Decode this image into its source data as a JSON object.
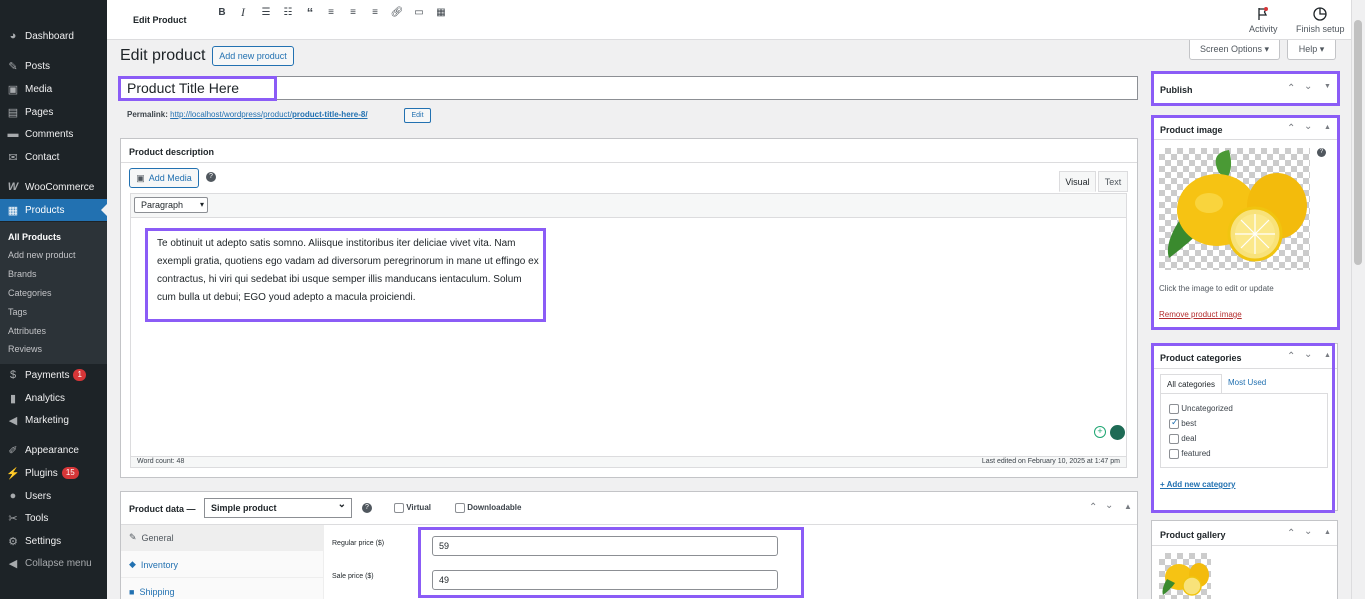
{
  "header": {
    "title": "Edit Product",
    "activity_label": "Activity",
    "finish_setup_label": "Finish setup"
  },
  "screen_options": "Screen Options ▾",
  "help": "Help ▾",
  "page": {
    "heading": "Edit product",
    "add_new": "Add new product",
    "product_title": "Product Title Here",
    "permalink_label": "Permalink:",
    "permalink_base": "http://localhost/wordpress/product/",
    "permalink_slug": "product-title-here-8/",
    "edit_slug": "Edit"
  },
  "sidebar": {
    "items": [
      {
        "label": "Dashboard",
        "icon": "dashboard-icon"
      },
      {
        "label": "Posts",
        "icon": "pin-icon"
      },
      {
        "label": "Media",
        "icon": "media-icon"
      },
      {
        "label": "Pages",
        "icon": "pages-icon"
      },
      {
        "label": "Comments",
        "icon": "comment-icon"
      },
      {
        "label": "Contact",
        "icon": "mail-icon"
      },
      {
        "label": "WooCommerce",
        "icon": "woo-icon"
      },
      {
        "label": "Products",
        "icon": "products-icon"
      },
      {
        "label": "Payments",
        "icon": "dollar-icon",
        "badge": "1"
      },
      {
        "label": "Analytics",
        "icon": "bar-chart-icon"
      },
      {
        "label": "Marketing",
        "icon": "megaphone-icon"
      },
      {
        "label": "Appearance",
        "icon": "brush-icon"
      },
      {
        "label": "Plugins",
        "icon": "plug-icon",
        "badge": "15"
      },
      {
        "label": "Users",
        "icon": "user-icon"
      },
      {
        "label": "Tools",
        "icon": "wrench-icon"
      },
      {
        "label": "Settings",
        "icon": "settings-icon"
      },
      {
        "label": "Collapse menu",
        "icon": "collapse-icon"
      }
    ],
    "submenu": [
      "All Products",
      "Add new product",
      "Brands",
      "Categories",
      "Tags",
      "Attributes",
      "Reviews"
    ]
  },
  "description_box": {
    "title": "Product description",
    "add_media": "Add Media",
    "tab_visual": "Visual",
    "tab_text": "Text",
    "format": "Paragraph",
    "content": "Te obtinuit ut adepto satis somno. Aliisque institoribus iter deliciae vivet vita. Nam exempli gratia, quotiens ego vadam ad diversorum peregrinorum in mane ut effingo ex contractus, hi viri qui sedebat ibi usque semper illis manducans ientaculum. Solum cum bulla ut debui; EGO youd adepto a macula proiciendi.",
    "word_count": "Word count: 48",
    "last_edited": "Last edited on February 10, 2025 at 1:47 pm"
  },
  "product_data": {
    "title": "Product data —",
    "type": "Simple product",
    "virtual": "Virtual",
    "downloadable": "Downloadable",
    "tabs": [
      {
        "label": "General",
        "icon": "wrench-icon"
      },
      {
        "label": "Inventory",
        "icon": "tag-icon"
      },
      {
        "label": "Shipping",
        "icon": "truck-icon"
      }
    ],
    "regular_price_label": "Regular price ($)",
    "regular_price": "59",
    "sale_price_label": "Sale price ($)",
    "sale_price": "49"
  },
  "publish_box": {
    "title": "Publish"
  },
  "image_box": {
    "title": "Product image",
    "hint": "Click the image to edit or update",
    "remove": "Remove product image"
  },
  "categories_box": {
    "title": "Product categories",
    "tab_all": "All categories",
    "tab_most": "Most Used",
    "items": [
      {
        "label": "Uncategorized",
        "checked": false
      },
      {
        "label": "best",
        "checked": true
      },
      {
        "label": "deal",
        "checked": false
      },
      {
        "label": "featured",
        "checked": false
      }
    ],
    "add_new": "+ Add new category"
  },
  "gallery_box": {
    "title": "Product gallery"
  },
  "colors": {
    "accent": "#2271b1",
    "highlight": "#8b5cf6",
    "sidebar": "#1d2327"
  }
}
